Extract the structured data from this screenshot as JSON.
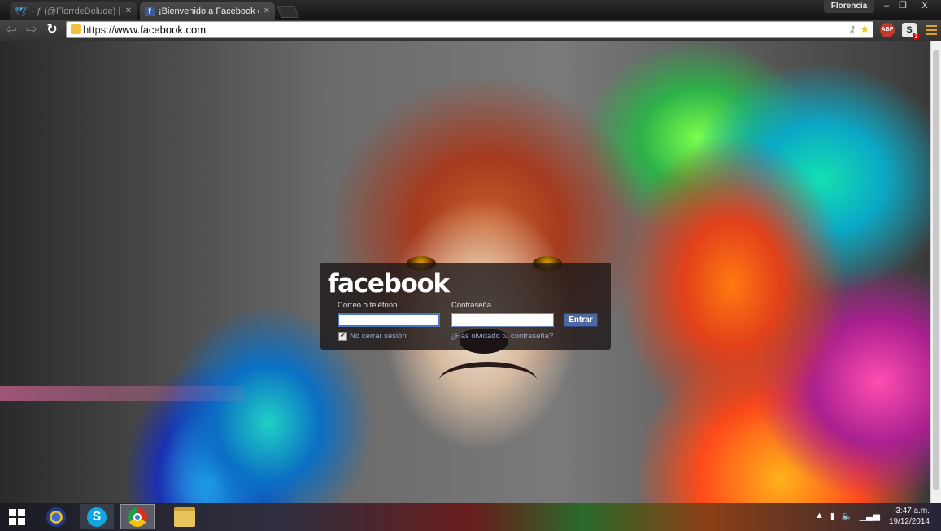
{
  "browser": {
    "tabs": [
      {
        "title": "- ƒ (@FlorrdeDelude) | Twi",
        "icon": "twitter-icon",
        "active": false
      },
      {
        "title": "¡Bienvenido a Facebook en",
        "icon": "facebook-icon",
        "active": true
      }
    ],
    "user_name": "Florencia",
    "window_controls": {
      "minimize": "–",
      "maximize": "❐",
      "close": "X"
    },
    "url_scheme": "https://",
    "url_host": "www.facebook.com",
    "extensions": {
      "abp_label": "ABP",
      "s_label": "S",
      "s_badge": "3"
    }
  },
  "login": {
    "logo": "facebook",
    "email_label": "Correo o teléfono",
    "password_label": "Contraseña",
    "email_value": "",
    "password_value": "",
    "submit_label": "Entrar",
    "keep_logged_in_label": "No cerrar sesión",
    "keep_logged_in_checked": true,
    "forgot_label": "¿Has olvidado tu contraseña?"
  },
  "taskbar": {
    "apps": [
      "app-launcher-icon",
      "skype-icon",
      "chrome-icon",
      "file-explorer-icon"
    ],
    "skype_letter": "S",
    "tray_icons": [
      "show-hidden-icons",
      "battery-icon",
      "volume-icon",
      "network-signal-icon"
    ],
    "clock_time": "3:47 a.m.",
    "clock_date": "19/12/2014"
  },
  "colors": {
    "facebook_blue": "#4e69a2",
    "link": "#98a9ca"
  }
}
